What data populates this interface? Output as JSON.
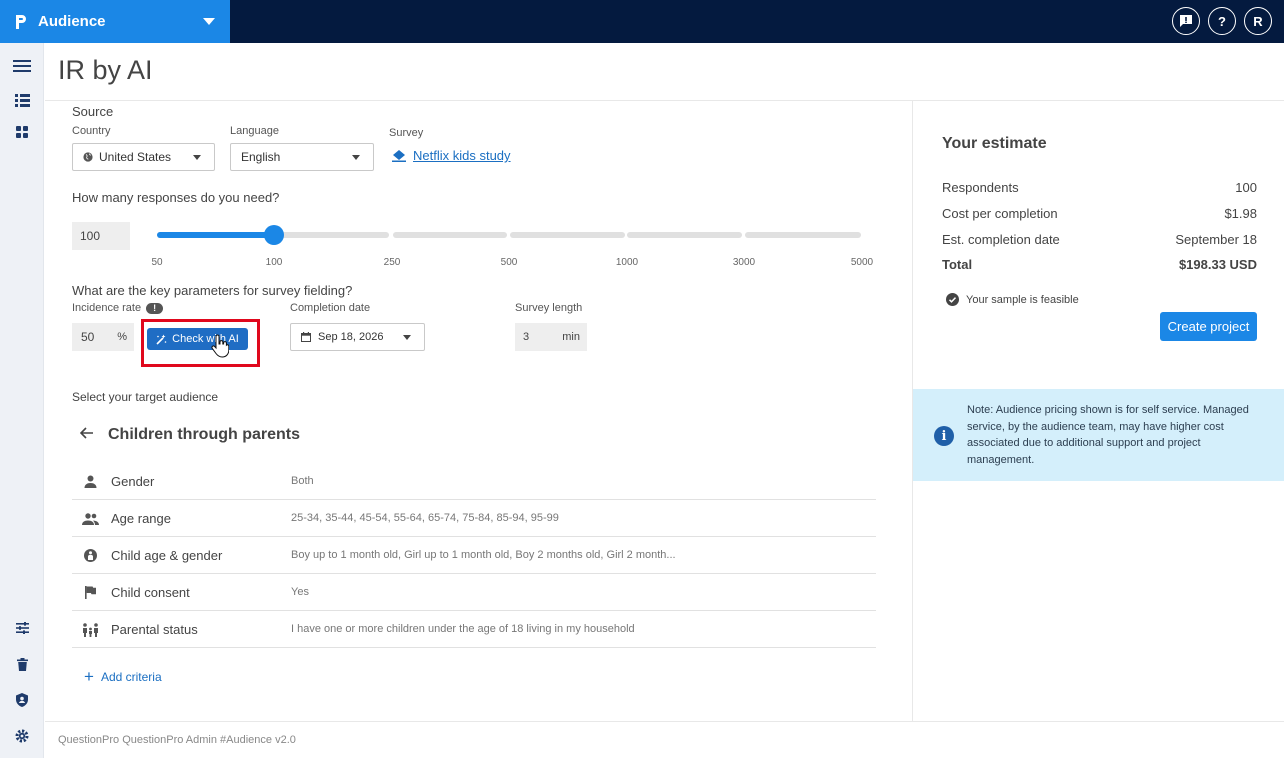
{
  "app": {
    "name": "Audience",
    "user_initial": "R"
  },
  "page": {
    "title": "IR by AI"
  },
  "source": {
    "heading": "Source",
    "country_label": "Country",
    "country_value": "United States",
    "language_label": "Language",
    "language_value": "English",
    "survey_label": "Survey",
    "survey_value": "Netflix kids study"
  },
  "responses": {
    "question": "How many responses do you need?",
    "value": "100",
    "ticks": [
      "50",
      "100",
      "250",
      "500",
      "1000",
      "3000",
      "5000"
    ],
    "selected_index": 1
  },
  "parameters": {
    "question": "What are the key parameters for survey fielding?",
    "incidence_label": "Incidence rate",
    "incidence_value": "50",
    "incidence_unit": "%",
    "ai_button": "Check with AI",
    "completion_label": "Completion date",
    "completion_value": "Sep 18, 2026",
    "length_label": "Survey length",
    "length_value": "3",
    "length_unit": "min"
  },
  "audience": {
    "heading": "Select your target audience",
    "title": "Children through parents",
    "criteria": [
      {
        "icon": "person-icon",
        "name": "Gender",
        "value": "Both"
      },
      {
        "icon": "people-icon",
        "name": "Age range",
        "value": "25-34, 35-44, 45-54, 55-64, 65-74, 75-84, 85-94, 95-99"
      },
      {
        "icon": "child-icon",
        "name": "Child age & gender",
        "value": "Boy up to 1 month old, Girl up to 1 month old, Boy 2 months old, Girl 2 month..."
      },
      {
        "icon": "flag-icon",
        "name": "Child consent",
        "value": "Yes"
      },
      {
        "icon": "family-icon",
        "name": "Parental status",
        "value": "I have one or more children under the age of 18 living in my household"
      }
    ],
    "add_criteria": "Add criteria"
  },
  "estimate": {
    "title": "Your estimate",
    "rows": [
      {
        "label": "Respondents",
        "value": "100"
      },
      {
        "label": "Cost per completion",
        "value": "$1.98"
      },
      {
        "label": "Est. completion date",
        "value": "September 18"
      },
      {
        "label": "Total",
        "value": "$198.33 USD"
      }
    ],
    "feasible": "Your sample is feasible",
    "create_button": "Create project",
    "note": "Note: Audience pricing shown is for self service. Managed service, by the audience team, may have higher cost associated due to additional support and project management."
  },
  "footer": {
    "text": "QuestionPro QuestionPro Admin  #Audience v2.0"
  },
  "colors": {
    "brand": "#1b87e6",
    "topbar": "#041a3f",
    "highlight": "#e0081d",
    "note_bg": "#d4effb"
  }
}
